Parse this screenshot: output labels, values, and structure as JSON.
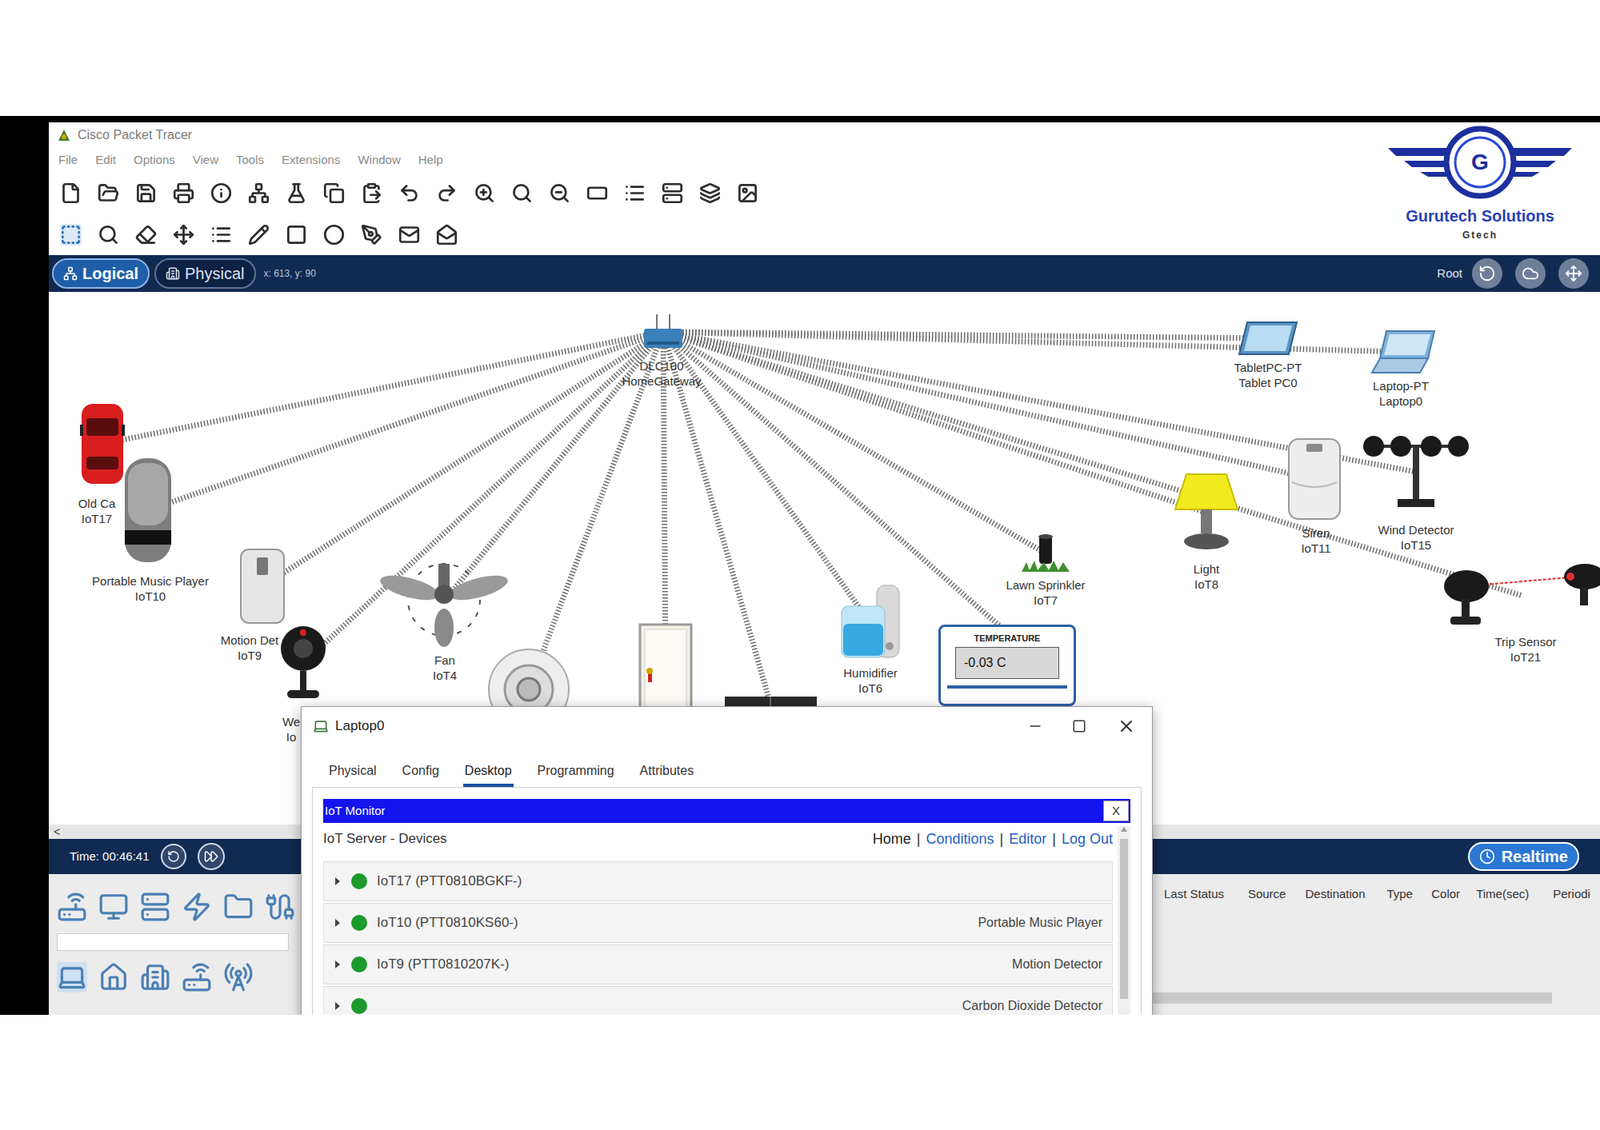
{
  "window": {
    "title": "Cisco Packet Tracer"
  },
  "menu": [
    "File",
    "Edit",
    "Options",
    "View",
    "Tools",
    "Extensions",
    "Window",
    "Help"
  ],
  "logo": {
    "mark": "G",
    "name": "Gurutech Solutions",
    "tagline": "Gtech"
  },
  "workspace_bar": {
    "tabs": [
      {
        "label": "Logical",
        "selected": true
      },
      {
        "label": "Physical",
        "selected": false
      }
    ],
    "coords": "x: 613, y: 90",
    "root": "Root"
  },
  "diagram": {
    "devices": [
      {
        "kind": "gateway",
        "labels": [
          "DLC100",
          "HomeGateway"
        ]
      },
      {
        "kind": "car",
        "labels": [
          "Old Ca",
          "IoT17"
        ]
      },
      {
        "kind": "music",
        "labels": [
          "Portable Music Player",
          "IoT10"
        ]
      },
      {
        "kind": "motion",
        "labels": [
          "Motion Det",
          "IoT9"
        ]
      },
      {
        "kind": "webcam",
        "labels": [
          "We",
          "Io"
        ]
      },
      {
        "kind": "fan",
        "labels": [
          "Fan",
          "IoT4"
        ]
      },
      {
        "kind": "smoke",
        "labels": []
      },
      {
        "kind": "door",
        "labels": []
      },
      {
        "kind": "window",
        "labels": []
      },
      {
        "kind": "humidifier",
        "labels": [
          "Humidifier",
          "IoT6"
        ]
      },
      {
        "kind": "sprinkler",
        "labels": [
          "Lawn Sprinkler",
          "IoT7"
        ]
      },
      {
        "kind": "light",
        "labels": [
          "Light",
          "IoT8"
        ]
      },
      {
        "kind": "siren",
        "labels": [
          "Siren",
          "IoT11"
        ]
      },
      {
        "kind": "wind",
        "labels": [
          "Wind Detector",
          "IoT15"
        ]
      },
      {
        "kind": "tablet",
        "labels": [
          "TabletPC-PT",
          "Tablet PC0"
        ]
      },
      {
        "kind": "laptop",
        "labels": [
          "Laptop-PT",
          "Laptop0"
        ]
      },
      {
        "kind": "trip",
        "labels": [
          "Trip Sensor",
          "IoT21"
        ]
      }
    ],
    "temperature": {
      "title": "TEMPERATURE",
      "reading": "-0.03 C"
    }
  },
  "h_scroll": {
    "arrow": "<"
  },
  "sim_bar": {
    "time": "Time: 00:46:41",
    "mode": "Realtime"
  },
  "event_table": {
    "columns": [
      "Last Status",
      "Source",
      "Destination",
      "Type",
      "Color",
      "Time(sec)",
      "Periodi"
    ]
  },
  "laptop_window": {
    "title": "Laptop0",
    "tabs": [
      {
        "label": "Physical",
        "selected": false
      },
      {
        "label": "Config",
        "selected": false
      },
      {
        "label": "Desktop",
        "selected": true
      },
      {
        "label": "Programming",
        "selected": false
      },
      {
        "label": "Attributes",
        "selected": false
      }
    ],
    "app": {
      "title": "IoT Monitor",
      "close": "X",
      "heading": "IoT Server - Devices",
      "separator": "|",
      "nav": [
        {
          "label": "Home",
          "link": false
        },
        {
          "label": "Conditions",
          "link": true
        },
        {
          "label": "Editor",
          "link": true
        },
        {
          "label": "Log Out",
          "link": true
        }
      ],
      "devices": [
        {
          "name": "IoT17 (PTT0810BGKF-)",
          "type": "",
          "online": true
        },
        {
          "name": "IoT10 (PTT0810KS60-)",
          "type": "Portable Music Player",
          "online": true
        },
        {
          "name": "IoT9 (PTT0810207K-)",
          "type": "Motion Detector",
          "online": true
        },
        {
          "name": "",
          "type": "Carbon Dioxide Detector",
          "online": true
        }
      ]
    }
  }
}
